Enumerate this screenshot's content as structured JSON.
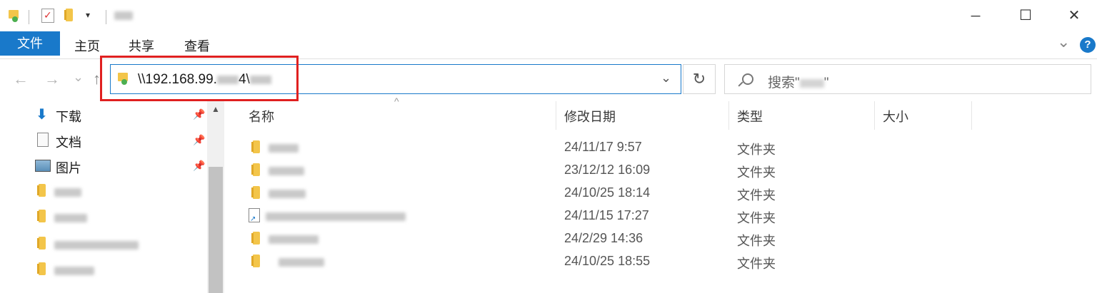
{
  "titlebar": {
    "icons": [
      "drive-icon",
      "properties-icon",
      "new-folder-icon",
      "dropdown-arrow-icon"
    ],
    "controls": {
      "minimize": "─",
      "maximize": "☐",
      "close": "✕"
    }
  },
  "ribbon": {
    "tabs": [
      {
        "label": "文件",
        "active": true
      },
      {
        "label": "主页"
      },
      {
        "label": "共享"
      },
      {
        "label": "查看"
      }
    ],
    "expand_glyph": "⌄",
    "help_glyph": "?"
  },
  "nav": {
    "back": "←",
    "forward": "→",
    "recent": "⌄",
    "up": "↑"
  },
  "address": {
    "prefix": "\\\\192.168.99.",
    "middle": "4\\",
    "dropdown": "⌄",
    "refresh": "↻"
  },
  "search": {
    "label": "搜索\"",
    "end": "\""
  },
  "sidebar": {
    "items": [
      {
        "label": "下载",
        "icon": "download-arrow-icon",
        "pinned": true
      },
      {
        "label": "文档",
        "icon": "document-icon",
        "pinned": true
      },
      {
        "label": "图片",
        "icon": "picture-icon",
        "pinned": true
      }
    ]
  },
  "columns": {
    "name": "名称",
    "modified": "修改日期",
    "type": "类型",
    "size": "大小"
  },
  "files": [
    {
      "date": "24/11/17 9:57",
      "type": "文件夹",
      "icon": "folder-icon"
    },
    {
      "date": "23/12/12 16:09",
      "type": "文件夹",
      "icon": "folder-icon"
    },
    {
      "date": "24/10/25 18:14",
      "type": "文件夹",
      "icon": "folder-icon"
    },
    {
      "date": "24/11/15 17:27",
      "type": "文件夹",
      "icon": "shortcut-icon"
    },
    {
      "date": "24/2/29 14:36",
      "type": "文件夹",
      "icon": "folder-icon"
    },
    {
      "date": "24/10/25 18:55",
      "type": "文件夹",
      "icon": "folder-icon"
    }
  ],
  "colors": {
    "accent": "#1979ca",
    "highlight_box": "#e02020",
    "folder": "#f3c54a"
  }
}
